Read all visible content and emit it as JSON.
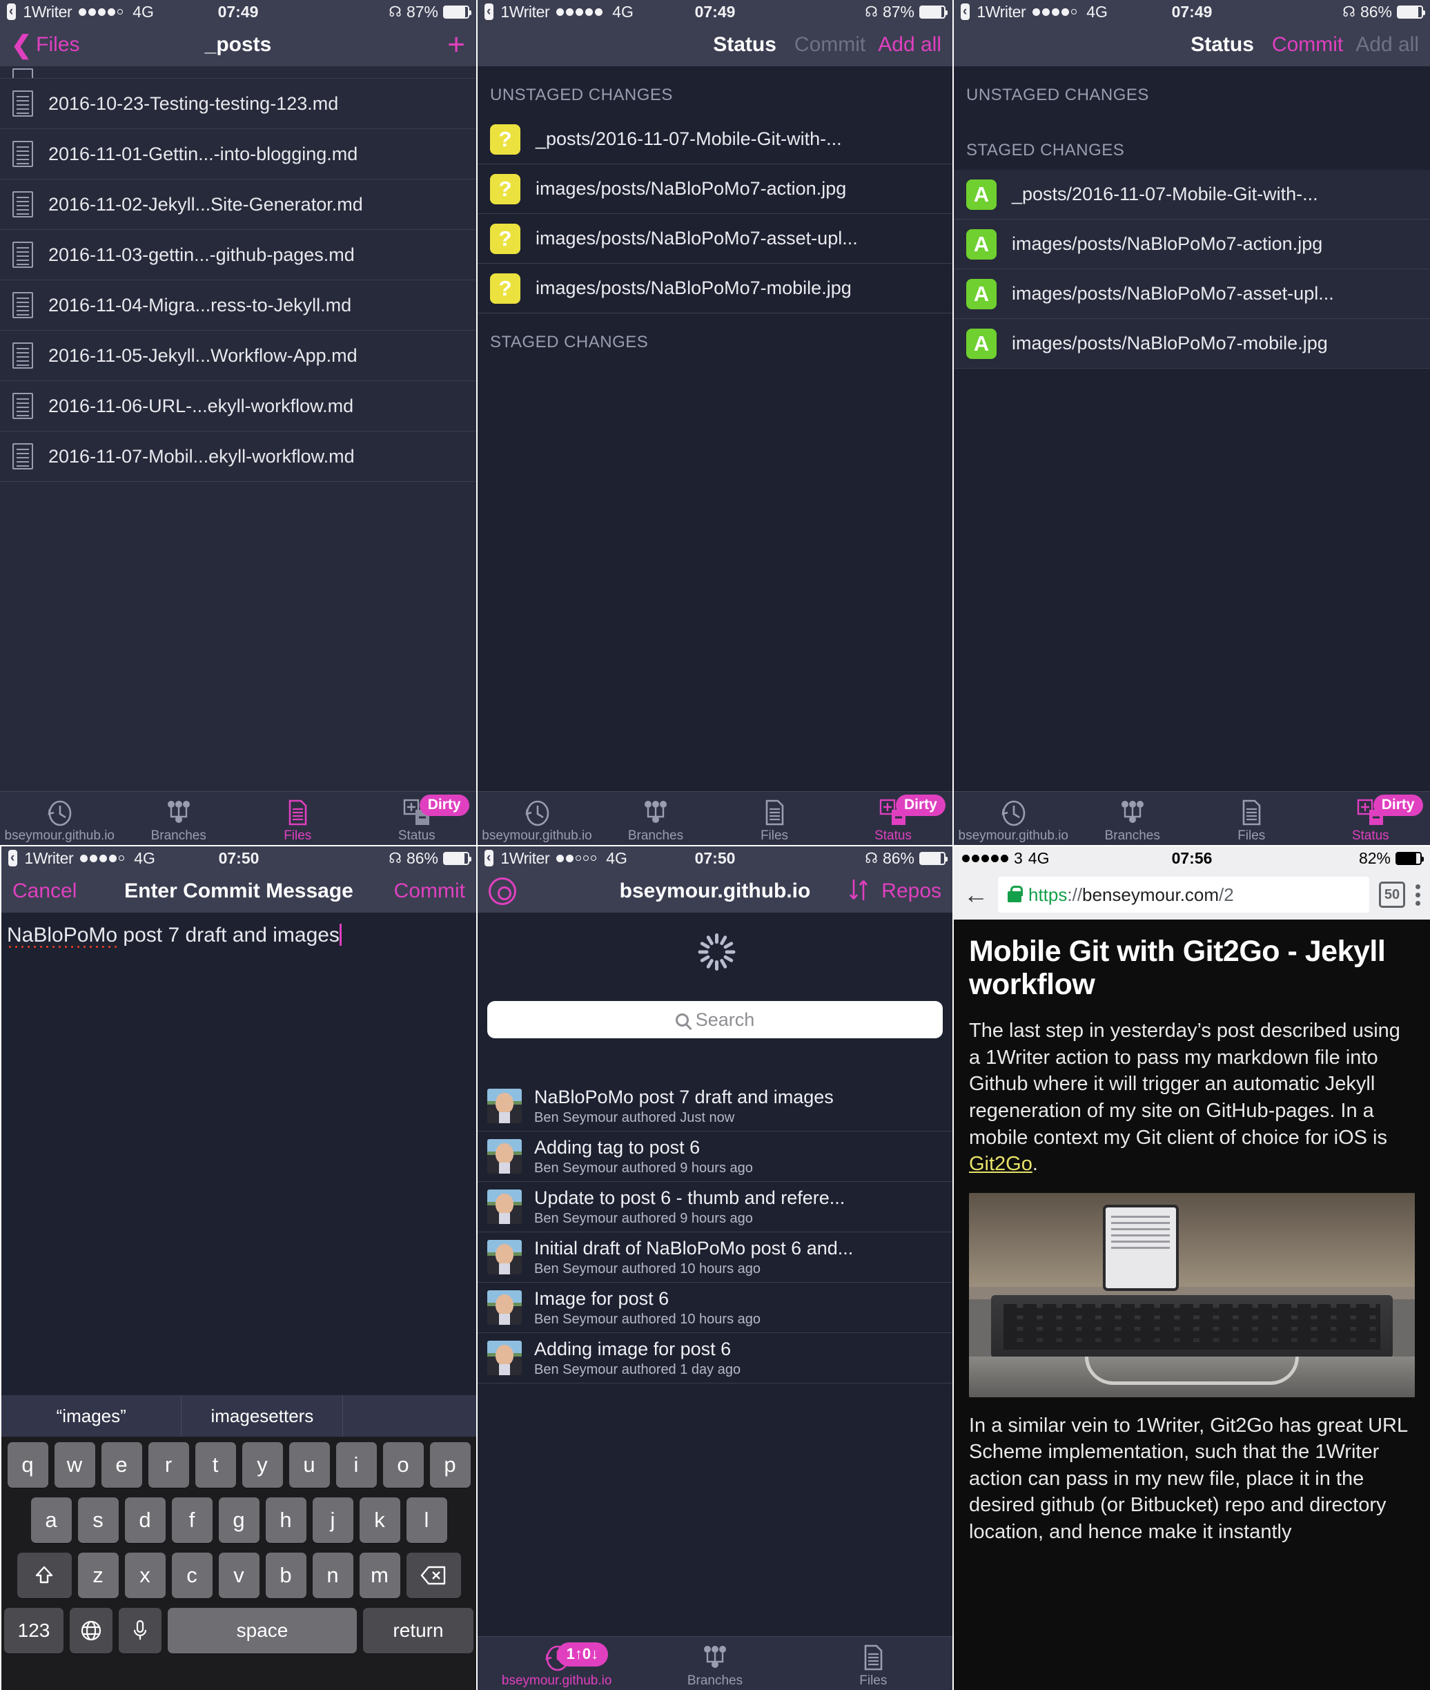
{
  "panels": {
    "files": {
      "status": {
        "app": "1Writer",
        "signal": 4,
        "signal_total": 5,
        "network": "4G",
        "time": "07:49",
        "battery": "87%"
      },
      "nav": {
        "back_label": "Files",
        "title": "_posts",
        "add_icon": "plus-icon"
      },
      "items": [
        "2016-10-23-Testing-testing-123.md",
        "2016-11-01-Gettin...-into-blogging.md",
        "2016-11-02-Jekyll...Site-Generator.md",
        "2016-11-03-gettin...-github-pages.md",
        "2016-11-04-Migra...ress-to-Jekyll.md",
        "2016-11-05-Jekyll...Workflow-App.md",
        "2016-11-06-URL-...ekyll-workflow.md",
        "2016-11-07-Mobil...ekyll-workflow.md"
      ],
      "tabs": [
        {
          "label": "bseymour.github.io",
          "icon": "history-clock-icon",
          "active": false,
          "badge": ""
        },
        {
          "label": "Branches",
          "icon": "branches-icon",
          "active": false,
          "badge": ""
        },
        {
          "label": "Files",
          "icon": "files-document-icon",
          "active": true,
          "badge": ""
        },
        {
          "label": "Status",
          "icon": "status-diff-icon",
          "active": false,
          "badge": "Dirty"
        }
      ]
    },
    "status_unstaged": {
      "status": {
        "app": "1Writer",
        "signal": 5,
        "signal_total": 5,
        "network": "4G",
        "time": "07:49",
        "battery": "87%"
      },
      "nav": {
        "title": "Status",
        "commit_label": "Commit",
        "commit_enabled": false,
        "addall_label": "Add all",
        "addall_enabled": true
      },
      "sections": [
        {
          "header": "UNSTAGED CHANGES",
          "rows": [
            {
              "flag": "?",
              "path": "_posts/2016-11-07-Mobile-Git-with-..."
            },
            {
              "flag": "?",
              "path": "images/posts/NaBloPoMo7-action.jpg"
            },
            {
              "flag": "?",
              "path": "images/posts/NaBloPoMo7-asset-upl..."
            },
            {
              "flag": "?",
              "path": "images/posts/NaBloPoMo7-mobile.jpg"
            }
          ]
        },
        {
          "header": "STAGED CHANGES",
          "rows": []
        }
      ],
      "tabs": [
        {
          "label": "bseymour.github.io",
          "icon": "history-clock-icon",
          "active": false,
          "badge": ""
        },
        {
          "label": "Branches",
          "icon": "branches-icon",
          "active": false,
          "badge": ""
        },
        {
          "label": "Files",
          "icon": "files-document-icon",
          "active": false,
          "badge": ""
        },
        {
          "label": "Status",
          "icon": "status-diff-icon",
          "active": true,
          "badge": "Dirty"
        }
      ]
    },
    "status_staged": {
      "status": {
        "app": "1Writer",
        "signal": 4,
        "signal_total": 5,
        "network": "4G",
        "time": "07:49",
        "battery": "86%"
      },
      "nav": {
        "title": "Status",
        "commit_label": "Commit",
        "commit_enabled": true,
        "addall_label": "Add all",
        "addall_enabled": false
      },
      "sections": [
        {
          "header": "UNSTAGED CHANGES",
          "rows": []
        },
        {
          "header": "STAGED CHANGES",
          "rows": [
            {
              "flag": "A",
              "path": "_posts/2016-11-07-Mobile-Git-with-..."
            },
            {
              "flag": "A",
              "path": "images/posts/NaBloPoMo7-action.jpg"
            },
            {
              "flag": "A",
              "path": "images/posts/NaBloPoMo7-asset-upl..."
            },
            {
              "flag": "A",
              "path": "images/posts/NaBloPoMo7-mobile.jpg"
            }
          ]
        }
      ],
      "tabs": [
        {
          "label": "bseymour.github.io",
          "icon": "history-clock-icon",
          "active": false,
          "badge": ""
        },
        {
          "label": "Branches",
          "icon": "branches-icon",
          "active": false,
          "badge": ""
        },
        {
          "label": "Files",
          "icon": "files-document-icon",
          "active": false,
          "badge": ""
        },
        {
          "label": "Status",
          "icon": "status-diff-icon",
          "active": true,
          "badge": "Dirty"
        }
      ]
    },
    "commit_message": {
      "status": {
        "app": "1Writer",
        "signal": 4,
        "signal_total": 5,
        "network": "4G",
        "time": "07:50",
        "battery": "86%"
      },
      "nav": {
        "cancel_label": "Cancel",
        "title": "Enter Commit Message",
        "commit_label": "Commit"
      },
      "input": {
        "value_misspelled": "NaBloPoMo",
        "value_rest": " post 7 draft and images"
      },
      "predictions": [
        "“images”",
        "imagesetters",
        ""
      ],
      "keyboard": {
        "row1": [
          "q",
          "w",
          "e",
          "r",
          "t",
          "y",
          "u",
          "i",
          "o",
          "p"
        ],
        "row2": [
          "a",
          "s",
          "d",
          "f",
          "g",
          "h",
          "j",
          "k",
          "l"
        ],
        "row3": [
          "z",
          "x",
          "c",
          "v",
          "b",
          "n",
          "m"
        ],
        "shift_icon": "shift-up-arrow-icon",
        "backspace_icon": "backspace-delete-icon",
        "numbers_label": "123",
        "globe_icon": "globe-language-icon",
        "mic_icon": "microphone-dictation-icon",
        "space_label": "space",
        "return_label": "return"
      }
    },
    "repo_history": {
      "status": {
        "app": "1Writer",
        "signal": 2,
        "signal_total": 5,
        "network": "4G",
        "time": "07:50",
        "battery": "86%"
      },
      "nav": {
        "settings_icon": "gear-settings-icon",
        "title": "bseymour.github.io",
        "sync_icon": "sync-down-up-arrows-icon",
        "repos_label": "Repos"
      },
      "loading_icon": "spinner-loading-icon",
      "search": {
        "placeholder": "Search",
        "icon": "search-magnifier-icon"
      },
      "commits": [
        {
          "title": "NaBloPoMo post 7 draft and images",
          "meta": "Ben Seymour authored Just now"
        },
        {
          "title": "Adding tag to post 6",
          "meta": "Ben Seymour authored 9 hours ago"
        },
        {
          "title": "Update to post 6 - thumb and refere...",
          "meta": "Ben Seymour authored 9 hours ago"
        },
        {
          "title": "Initial draft of NaBloPoMo post 6 and...",
          "meta": "Ben Seymour authored 10 hours ago"
        },
        {
          "title": "Image for post 6",
          "meta": "Ben Seymour authored 10 hours ago"
        },
        {
          "title": "Adding image for post 6",
          "meta": "Ben Seymour authored 1 day ago"
        }
      ],
      "tabs": [
        {
          "label": "bseymour.github.io",
          "icon": "history-clock-icon",
          "active": true,
          "badge": "1↑0↓"
        },
        {
          "label": "Branches",
          "icon": "branches-icon",
          "active": false,
          "badge": ""
        },
        {
          "label": "Files",
          "icon": "files-document-icon",
          "active": false,
          "badge": ""
        }
      ]
    },
    "browser": {
      "status": {
        "signal": 5,
        "signal_total": 5,
        "carrier": "3",
        "network": "4G",
        "time": "07:56",
        "battery": "82%"
      },
      "chrome": {
        "back_icon": "back-arrow-icon",
        "lock_icon": "secure-lock-icon",
        "url_scheme": "https",
        "url_sep": "://",
        "url_host": "benseymour.com",
        "url_path": "/2",
        "tab_count": "50",
        "menu_icon": "kebab-menu-icon"
      },
      "article": {
        "title": "Mobile Git with Git2Go - Jekyll workflow",
        "para1_a": "The last step in yesterday’s post described using a 1Writer action to pass my markdown file into Github where it will trigger an automatic Jekyll regeneration of my site on GitHub-pages. In a mobile context my Git client of choice for iOS is ",
        "para1_link": "Git2Go",
        "para1_b": ".",
        "image_alt": "photo of iPhone propped on desk beside bluetooth keyboard",
        "para2": "In a similar vein to 1Writer, Git2Go has great URL Scheme implementation, such that the 1Writer action can pass in my new file, place it in the desired github (or Bitbucket) repo and directory location, and hence make it instantly"
      }
    }
  },
  "colors": {
    "accent": "#e040c0",
    "nav_bg": "#3c3f52",
    "body_bg": "#272a3a",
    "untracked": "#ece23f",
    "added": "#6fd030",
    "link": "#e8e36a",
    "secure": "#14a04a"
  }
}
